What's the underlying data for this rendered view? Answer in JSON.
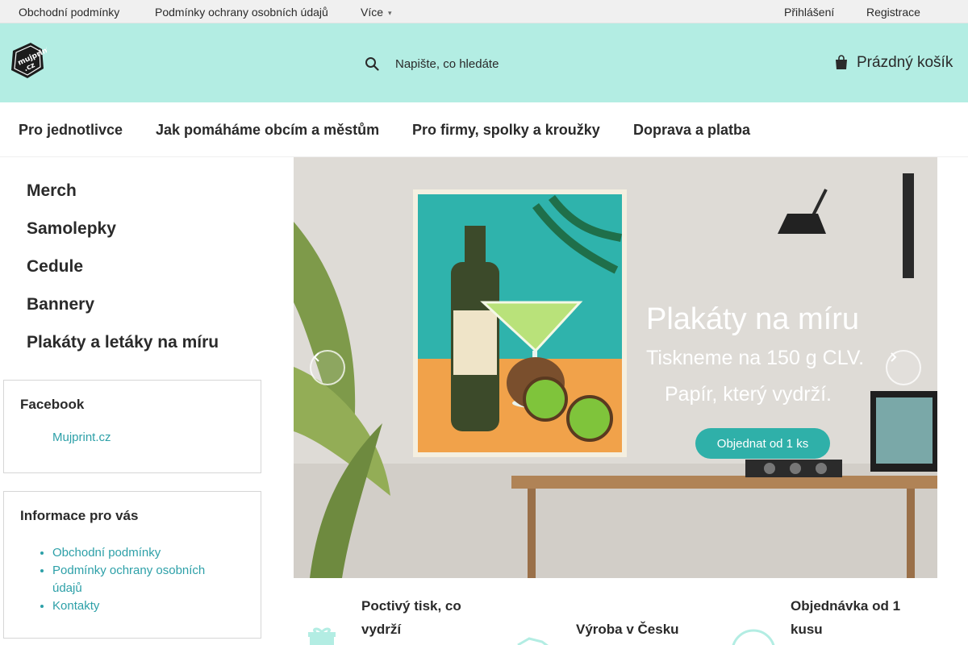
{
  "topbar": {
    "links": [
      "Obchodní podmínky",
      "Podmínky ochrany osobních údajů",
      "Více"
    ],
    "login": "Přihlášení",
    "register": "Registrace"
  },
  "header": {
    "logo_alt": "Mujprint.cz",
    "search_placeholder": "Napište, co hledáte",
    "cart_label": "Prázdný košík"
  },
  "mainnav": [
    "Pro jednotlivce",
    "Jak pomáháme obcím a městům",
    "Pro firmy, spolky a kroužky",
    "Doprava a platba"
  ],
  "categories": [
    "Merch",
    "Samolepky",
    "Cedule",
    "Bannery",
    "Plakáty a letáky na míru"
  ],
  "facebook": {
    "title": "Facebook",
    "link": "Mujprint.cz"
  },
  "info": {
    "title": "Informace pro vás",
    "links": [
      "Obchodní podmínky",
      "Podmínky ochrany osobních údajů",
      "Kontakty"
    ]
  },
  "banner": {
    "title": "Plakáty na míru",
    "subtitle1": "Tiskneme na 150 g CLV.",
    "subtitle2": "Papír, který vydrží.",
    "cta": "Objednat od 1 ks"
  },
  "features": [
    {
      "text": "Poctivý tisk, co vydrží",
      "icon": "gift-icon"
    },
    {
      "text": "Výroba v Česku",
      "icon": "map-icon"
    },
    {
      "text": "Objednávka od 1 kusu",
      "icon": "one-icon"
    }
  ],
  "colors": {
    "header_bg": "#b3ede3",
    "link": "#2da0a8",
    "accent": "#2fb0a9"
  }
}
